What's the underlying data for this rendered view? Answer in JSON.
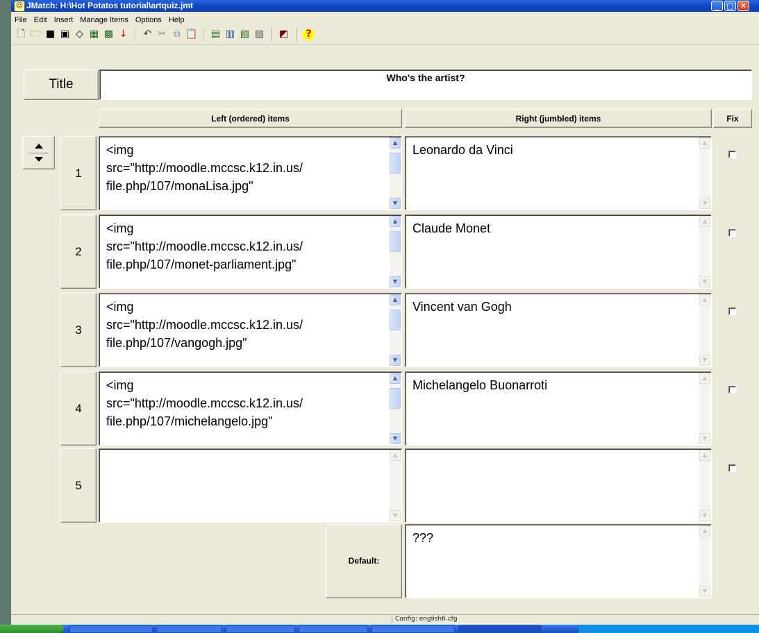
{
  "window": {
    "title": "JMatch: H:\\Hot Potatos tutorial\\artquiz.jmt"
  },
  "menu": [
    "File",
    "Edit",
    "Insert",
    "Manage Items",
    "Options",
    "Help"
  ],
  "title_button": "Title",
  "title_value": "Who's the artist?",
  "headers": {
    "left": "Left (ordered) items",
    "right": "Right (jumbled) items",
    "fix": "Fix"
  },
  "rows": [
    {
      "num": "1",
      "left": "<img\nsrc=\"http://moodle.mccsc.k12.in.us/\nfile.php/107/monaLisa.jpg\"",
      "right": "Leonardo da Vinci",
      "fix": false
    },
    {
      "num": "2",
      "left": "<img\nsrc=\"http://moodle.mccsc.k12.in.us/\nfile.php/107/monet-parliament.jpg\"",
      "right": "Claude Monet",
      "fix": false
    },
    {
      "num": "3",
      "left": "<img\nsrc=\"http://moodle.mccsc.k12.in.us/\nfile.php/107/vangogh.jpg\"",
      "right": "Vincent van Gogh",
      "fix": false
    },
    {
      "num": "4",
      "left": "<img\nsrc=\"http://moodle.mccsc.k12.in.us/\nfile.php/107/michelangelo.jpg\"",
      "right": "Michelangelo Buonarroti",
      "fix": false
    },
    {
      "num": "5",
      "left": "",
      "right": "",
      "fix": false
    }
  ],
  "default_label": "Default:",
  "default_value": "???",
  "status": "Config: english6.cfg",
  "icons": [
    "new-file-icon",
    "open-folder-icon",
    "save-icon",
    "save-as-icon",
    "eraser-icon",
    "create-web-page-icon",
    "create-web-page-v6-icon",
    "down-arrow-icon",
    "undo-icon",
    "cut-icon",
    "copy-icon",
    "paste-icon",
    "hotpot-icon-1",
    "hotpot-icon-2",
    "hotpot-icon-3",
    "hotpot-icon-4",
    "masher-icon",
    "help-icon"
  ]
}
